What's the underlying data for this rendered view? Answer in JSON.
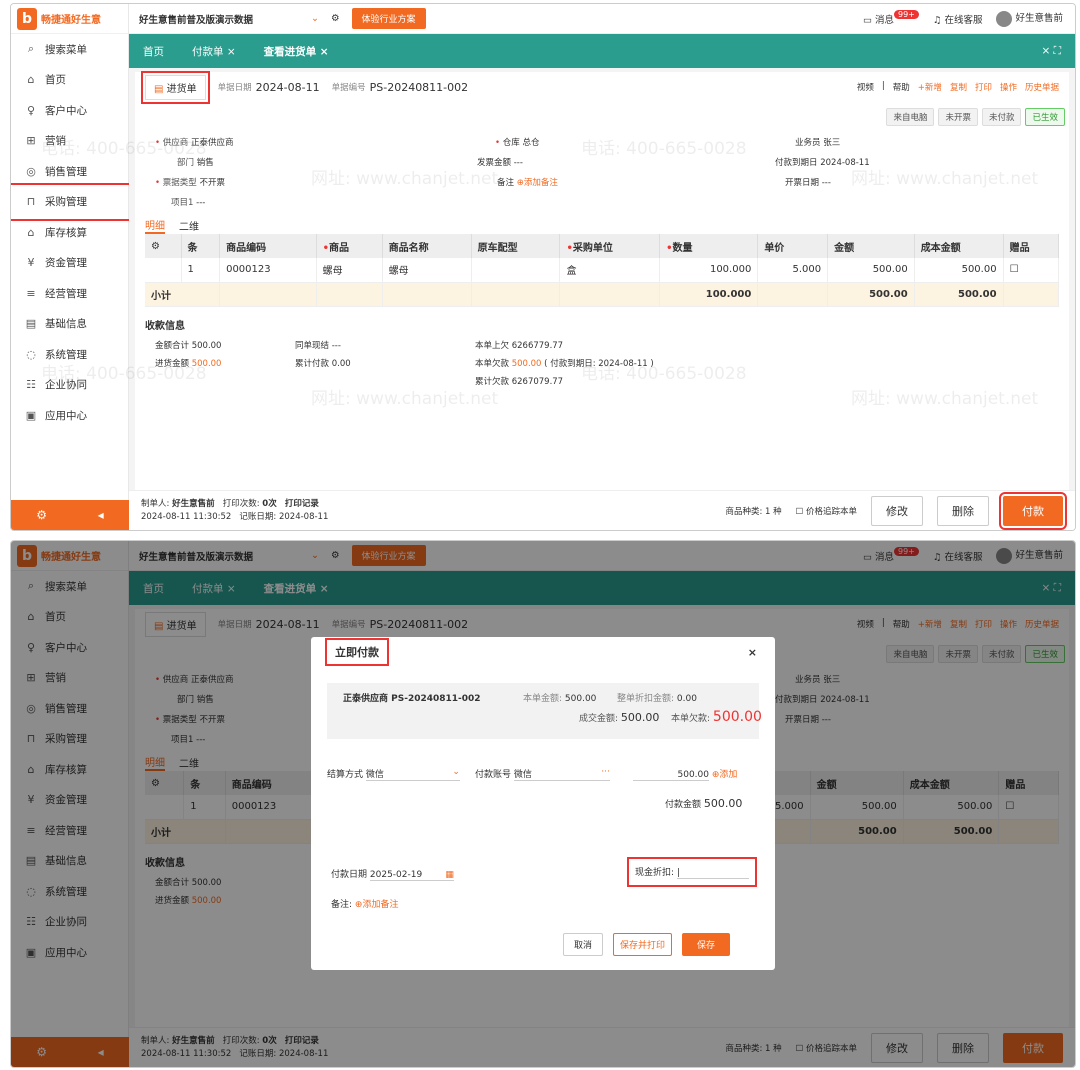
{
  "sidebar": {
    "logo_text": "畅捷通好生意",
    "items": [
      {
        "icon": "⌕",
        "label": "搜索菜单"
      },
      {
        "icon": "⌂",
        "label": "首页"
      },
      {
        "icon": "♀",
        "label": "客户中心"
      },
      {
        "icon": "⊞",
        "label": "营销"
      },
      {
        "icon": "◎",
        "label": "销售管理"
      },
      {
        "icon": "⊓",
        "label": "采购管理"
      },
      {
        "icon": "⌂",
        "label": "库存核算"
      },
      {
        "icon": "¥",
        "label": "资金管理"
      },
      {
        "icon": "≡",
        "label": "经营管理"
      },
      {
        "icon": "▤",
        "label": "基础信息"
      },
      {
        "icon": "◌",
        "label": "系统管理"
      },
      {
        "icon": "☷",
        "label": "企业协同"
      },
      {
        "icon": "▣",
        "label": "应用中心"
      }
    ]
  },
  "topbar": {
    "org": "好生意售前普及版演示数据",
    "trial": "体验行业方案",
    "messages": "消息",
    "msg_badge": "99+",
    "service": "在线客服",
    "user": "好生意售前"
  },
  "tabs": [
    "首页",
    "付款单",
    "查看进货单"
  ],
  "doc": {
    "type": "进货单",
    "date_label": "单据日期",
    "date": "2024-08-11",
    "no_label": "单据编号",
    "no": "PS-20240811-002"
  },
  "tools": [
    "视频",
    "帮助",
    "新增",
    "复制",
    "打印",
    "操作",
    "历史单据"
  ],
  "status": [
    "来自电脑",
    "未开票",
    "未付款",
    "已生效"
  ],
  "form": {
    "supplier_l": "供应商",
    "supplier": "正泰供应商",
    "dept_l": "部门",
    "dept": "销售",
    "ticket_l": "票据类型",
    "ticket": "不开票",
    "proj_l": "项目1",
    "proj": "---",
    "wh_l": "仓库",
    "wh": "总仓",
    "invamt_l": "发票金额",
    "invamt": "---",
    "note_l": "备注",
    "add_note": "添加备注",
    "sales_l": "业务员",
    "sales": "张三",
    "due_l": "付款到期日",
    "due": "2024-08-11",
    "invdate_l": "开票日期",
    "invdate": "---"
  },
  "subtabs": [
    "明细",
    "二维"
  ],
  "grid": {
    "headers": [
      "条",
      "商品编码",
      "商品",
      "商品名称",
      "原车配型",
      "采购单位",
      "数量",
      "单价",
      "金额",
      "成本金额",
      "赠品"
    ],
    "rows": [
      [
        "1",
        "0000123",
        "螺母",
        "螺母",
        "",
        "盒",
        "100.000",
        "5.000",
        "500.00",
        "500.00",
        ""
      ]
    ],
    "subtotal": {
      "label": "小计",
      "qty": "100.000",
      "amount": "500.00",
      "cost": "500.00"
    }
  },
  "pay": {
    "title": "收款信息",
    "total_l": "金额合计",
    "total": "500.00",
    "in_l": "进货金额",
    "in": "500.00",
    "cash_l": "同单现结",
    "cash": "---",
    "acc_l": "累计付款",
    "acc": "0.00",
    "prev_l": "本单上欠",
    "prev": "6266779.77",
    "owe_l": "本单欠款",
    "owe": "500.00",
    "owe_note": "( 付款到期日: 2024-08-11 )",
    "accowe_l": "累计欠款",
    "accowe": "6267079.77"
  },
  "footer": {
    "maker_l": "制单人:",
    "maker": "好生意售前",
    "print_l": "打印次数:",
    "print": "0次",
    "print_rec": "打印记录",
    "created": "2024-08-11 11:30:52",
    "rec_l": "记账日期:",
    "rec": "2024-08-11",
    "kinds_l": "商品种类:",
    "kinds": "1 种",
    "track": "价格追踪本单",
    "edit": "修改",
    "del": "删除",
    "pay": "付款"
  },
  "modal": {
    "title": "立即付款",
    "close": "×",
    "supplier": "正泰供应商 PS-20240811-002",
    "amt_l": "本单金额:",
    "amt": "500.00",
    "disc_l": "整单折扣金额:",
    "disc": "0.00",
    "deal_l": "成交金额:",
    "deal": "500.00",
    "owe_l": "本单欠款:",
    "owe": "500.00",
    "method_l": "结算方式",
    "method": "微信",
    "acct_l": "付款账号",
    "acct": "微信",
    "line_amt": "500.00",
    "add": "添加",
    "payamt_l": "付款金额",
    "payamt": "500.00",
    "date_l": "付款日期",
    "date": "2025-02-19",
    "note_l": "备注:",
    "add_note": "添加备注",
    "cashdisc_l": "现金折扣:",
    "cancel": "取消",
    "save_print": "保存并打印",
    "save": "保存"
  },
  "watermark": [
    "电话: 400-665-0028",
    "网址: www.chanjet.net"
  ],
  "colors": {
    "accent": "#f26a21",
    "teal": "#2a9d8f",
    "highlight": "#e33333"
  }
}
